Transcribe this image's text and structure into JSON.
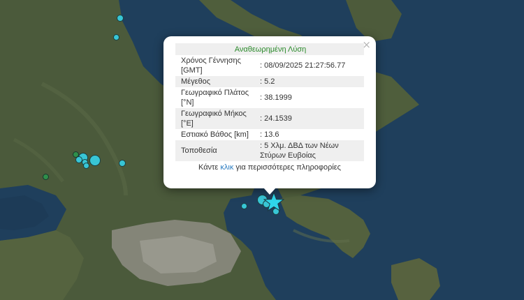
{
  "popup": {
    "title": "Αναθεωρημένη Λύση",
    "close_label": "×",
    "rows": [
      {
        "key": "Χρόνος Γέννησης [GMT]",
        "value": ": 08/09/2025 21:27:56.77"
      },
      {
        "key": "Μέγεθος",
        "value": ": 5.2"
      },
      {
        "key": "Γεωγραφικό Πλάτος [°N]",
        "value": ": 38.1999"
      },
      {
        "key": "Γεωγραφικό Μήκος [°E]",
        "value": ": 24.1539"
      },
      {
        "key": "Εστιακό Βάθος [km]",
        "value": ": 13.6"
      },
      {
        "key": "Τοποθεσία",
        "value": ": 5 Χλμ. ΔΒΔ των Νέων Στύρων Ευβοίας"
      }
    ],
    "more_prefix": "Κάντε ",
    "more_link": "κλικ",
    "more_suffix": " για περισσότερες πληροφορίες"
  },
  "colors": {
    "sea": "#1f3f5c",
    "land": "#4a5a3a",
    "urban": "#8f8f86",
    "quake_recent": "#38c6d6",
    "quake_older": "#2f8f4a",
    "epicenter_star": "#2fd6ea"
  },
  "markers": {
    "epicenter_icon": "star-icon",
    "quake_icon": "circle-icon"
  }
}
